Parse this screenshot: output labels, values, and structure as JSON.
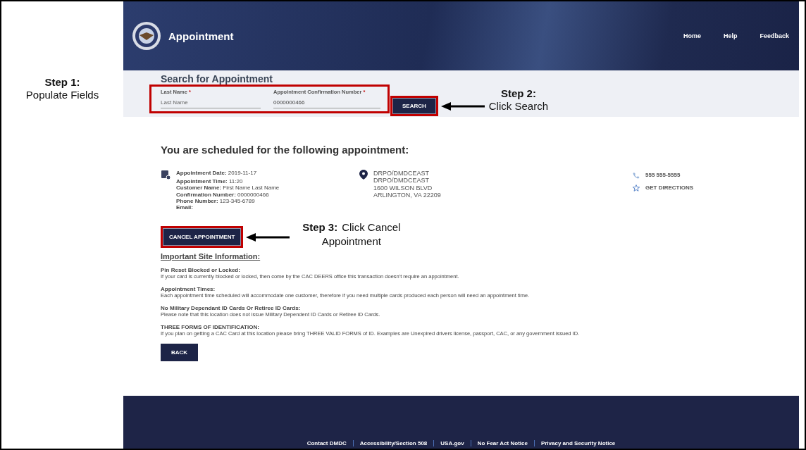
{
  "annotations": [
    {
      "step": "Step 1:",
      "text": "Populate Fields"
    },
    {
      "step": "Step 2:",
      "text": "Click Search"
    },
    {
      "step": "Step 3:",
      "text": "Click Cancel Appointment"
    }
  ],
  "header": {
    "title": "Appointment",
    "nav": [
      "Home",
      "Help",
      "Feedback"
    ]
  },
  "search": {
    "title": "Search for Appointment",
    "fields": [
      {
        "label": "Last Name",
        "required_mark": "*",
        "placeholder": "Last Name"
      },
      {
        "label": "Appointment Confirmation Number",
        "required_mark": "*",
        "value": "0000000466"
      }
    ],
    "button": "SEARCH"
  },
  "appointment": {
    "heading": "You are scheduled for the following appointment:",
    "details": [
      "**Appointment Date:** 2019-11-17",
      "**Appointment Time:** 11:20",
      "**Customer Name:** First Name Last Name",
      "**Confirmation Number:** 0000000466",
      "**Phone Number:** 123-345-6789",
      "**Email:**"
    ],
    "location": [
      "DRPO/DMDCEAST",
      "DRPO/DMDCEAST",
      "1600 WILSON BLVD",
      "ARLINGTON, VA 22209"
    ],
    "phone": "555 555-5555",
    "directions": "GET DIRECTIONS",
    "cancel_button": "CANCEL APPOINTMENT"
  },
  "site_info": {
    "title": "Important Site Information:",
    "sections": [
      {
        "title": "Pin Reset Blocked or Locked:",
        "text": "If your card is currently blocked or locked, then come by the CAC DEERS office this transaction doesn't require an appointment."
      },
      {
        "title": "Appointment Times:",
        "text": "Each appointment time scheduled will accommodate one customer, therefore if you need multiple cards produced each person will need an appointment time."
      },
      {
        "title": "No Military Dependant ID Cards Or Retiree ID Cards:",
        "text": "Please note that this location does not issue Military Dependent ID Cards or Retiree ID Cards."
      },
      {
        "title": "THREE FORMS OF IDENTIFICATION:",
        "text": "If you plan on getting a CAC Card at this location please bring THREE VALID FORMS of ID. Examples are Unexpired drivers license, passport, CAC, or any government issued ID."
      }
    ],
    "back_button": "BACK"
  },
  "footer": {
    "links": [
      "Contact DMDC",
      "Accessibility/Section 508",
      "USA.gov",
      "No Fear Act Notice",
      "Privacy and Security Notice"
    ]
  }
}
